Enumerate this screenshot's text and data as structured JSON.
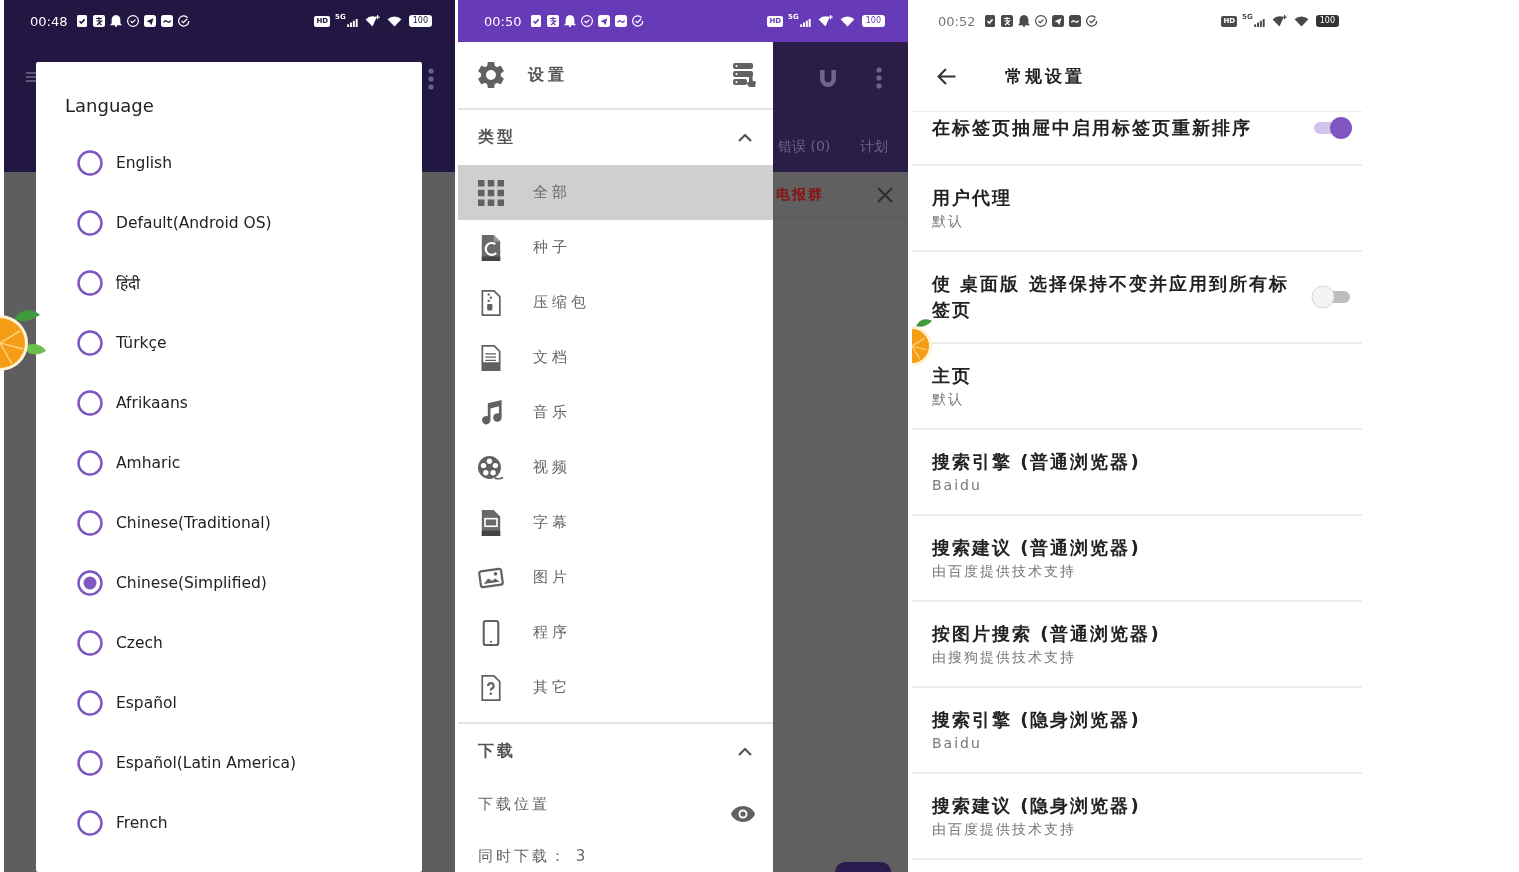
{
  "language_screen": {
    "status_bar": {
      "time": "00:48",
      "hd_badge": "HD",
      "network": "5G",
      "battery": "100"
    },
    "dialog": {
      "title": "Language",
      "options": [
        {
          "label": "English",
          "selected": false
        },
        {
          "label": "Default(Android OS)",
          "selected": false
        },
        {
          "label": "हिंदी",
          "selected": false
        },
        {
          "label": "Türkçe",
          "selected": false
        },
        {
          "label": "Afrikaans",
          "selected": false
        },
        {
          "label": "Amharic",
          "selected": false
        },
        {
          "label": "Chinese(Traditional)",
          "selected": false
        },
        {
          "label": "Chinese(Simplified)",
          "selected": true
        },
        {
          "label": "Czech",
          "selected": false
        },
        {
          "label": "Español",
          "selected": false
        },
        {
          "label": "Español(Latin America)",
          "selected": false
        },
        {
          "label": "French",
          "selected": false
        }
      ]
    }
  },
  "drawer_screen": {
    "status_bar": {
      "time": "00:50",
      "hd_badge": "HD",
      "network": "5G",
      "battery": "100"
    },
    "drawer": {
      "title": "设置",
      "sections": [
        {
          "kind": "types",
          "title": "类型",
          "expanded": true,
          "items": [
            {
              "label": "全部",
              "selected": true
            },
            {
              "label": "种子",
              "selected": false
            },
            {
              "label": "压缩包",
              "selected": false
            },
            {
              "label": "文档",
              "selected": false
            },
            {
              "label": "音乐",
              "selected": false
            },
            {
              "label": "视频",
              "selected": false
            },
            {
              "label": "字幕",
              "selected": false
            },
            {
              "label": "图片",
              "selected": false
            },
            {
              "label": "程序",
              "selected": false
            },
            {
              "label": "其它",
              "selected": false
            }
          ]
        },
        {
          "kind": "settings",
          "title": "下载",
          "expanded": true,
          "items": [
            {
              "label": "下载位置"
            },
            {
              "label": "同时下载： 3"
            }
          ]
        }
      ]
    },
    "background": {
      "tabs": [
        "错误 (0)",
        "计划"
      ],
      "banner": "电报群"
    }
  },
  "settings_screen": {
    "status_bar": {
      "time": "00:52",
      "hd_badge": "HD",
      "network": "5G",
      "battery": "100"
    },
    "title": "常规设置",
    "items": [
      {
        "kind": "switch",
        "title": "在标签页抽屉中启用标签页重新排序",
        "on": true
      },
      {
        "kind": "value",
        "title": "用户代理",
        "summary": "默认"
      },
      {
        "kind": "switch",
        "title": "使 桌面版 选择保持不变并应用到所有标签页",
        "on": false
      },
      {
        "kind": "value",
        "title": "主页",
        "summary": "默认"
      },
      {
        "kind": "value",
        "title": "搜索引擎 (普通浏览器)",
        "summary": "Baidu"
      },
      {
        "kind": "value",
        "title": "搜索建议 (普通浏览器)",
        "summary": "由百度提供技术支持"
      },
      {
        "kind": "value",
        "title": "按图片搜索 (普通浏览器)",
        "summary": "由搜狗提供技术支持"
      },
      {
        "kind": "value",
        "title": "搜索引擎 (隐身浏览器)",
        "summary": "Baidu"
      },
      {
        "kind": "value",
        "title": "搜索建议 (隐身浏览器)",
        "summary": "由百度提供技术支持"
      }
    ]
  }
}
